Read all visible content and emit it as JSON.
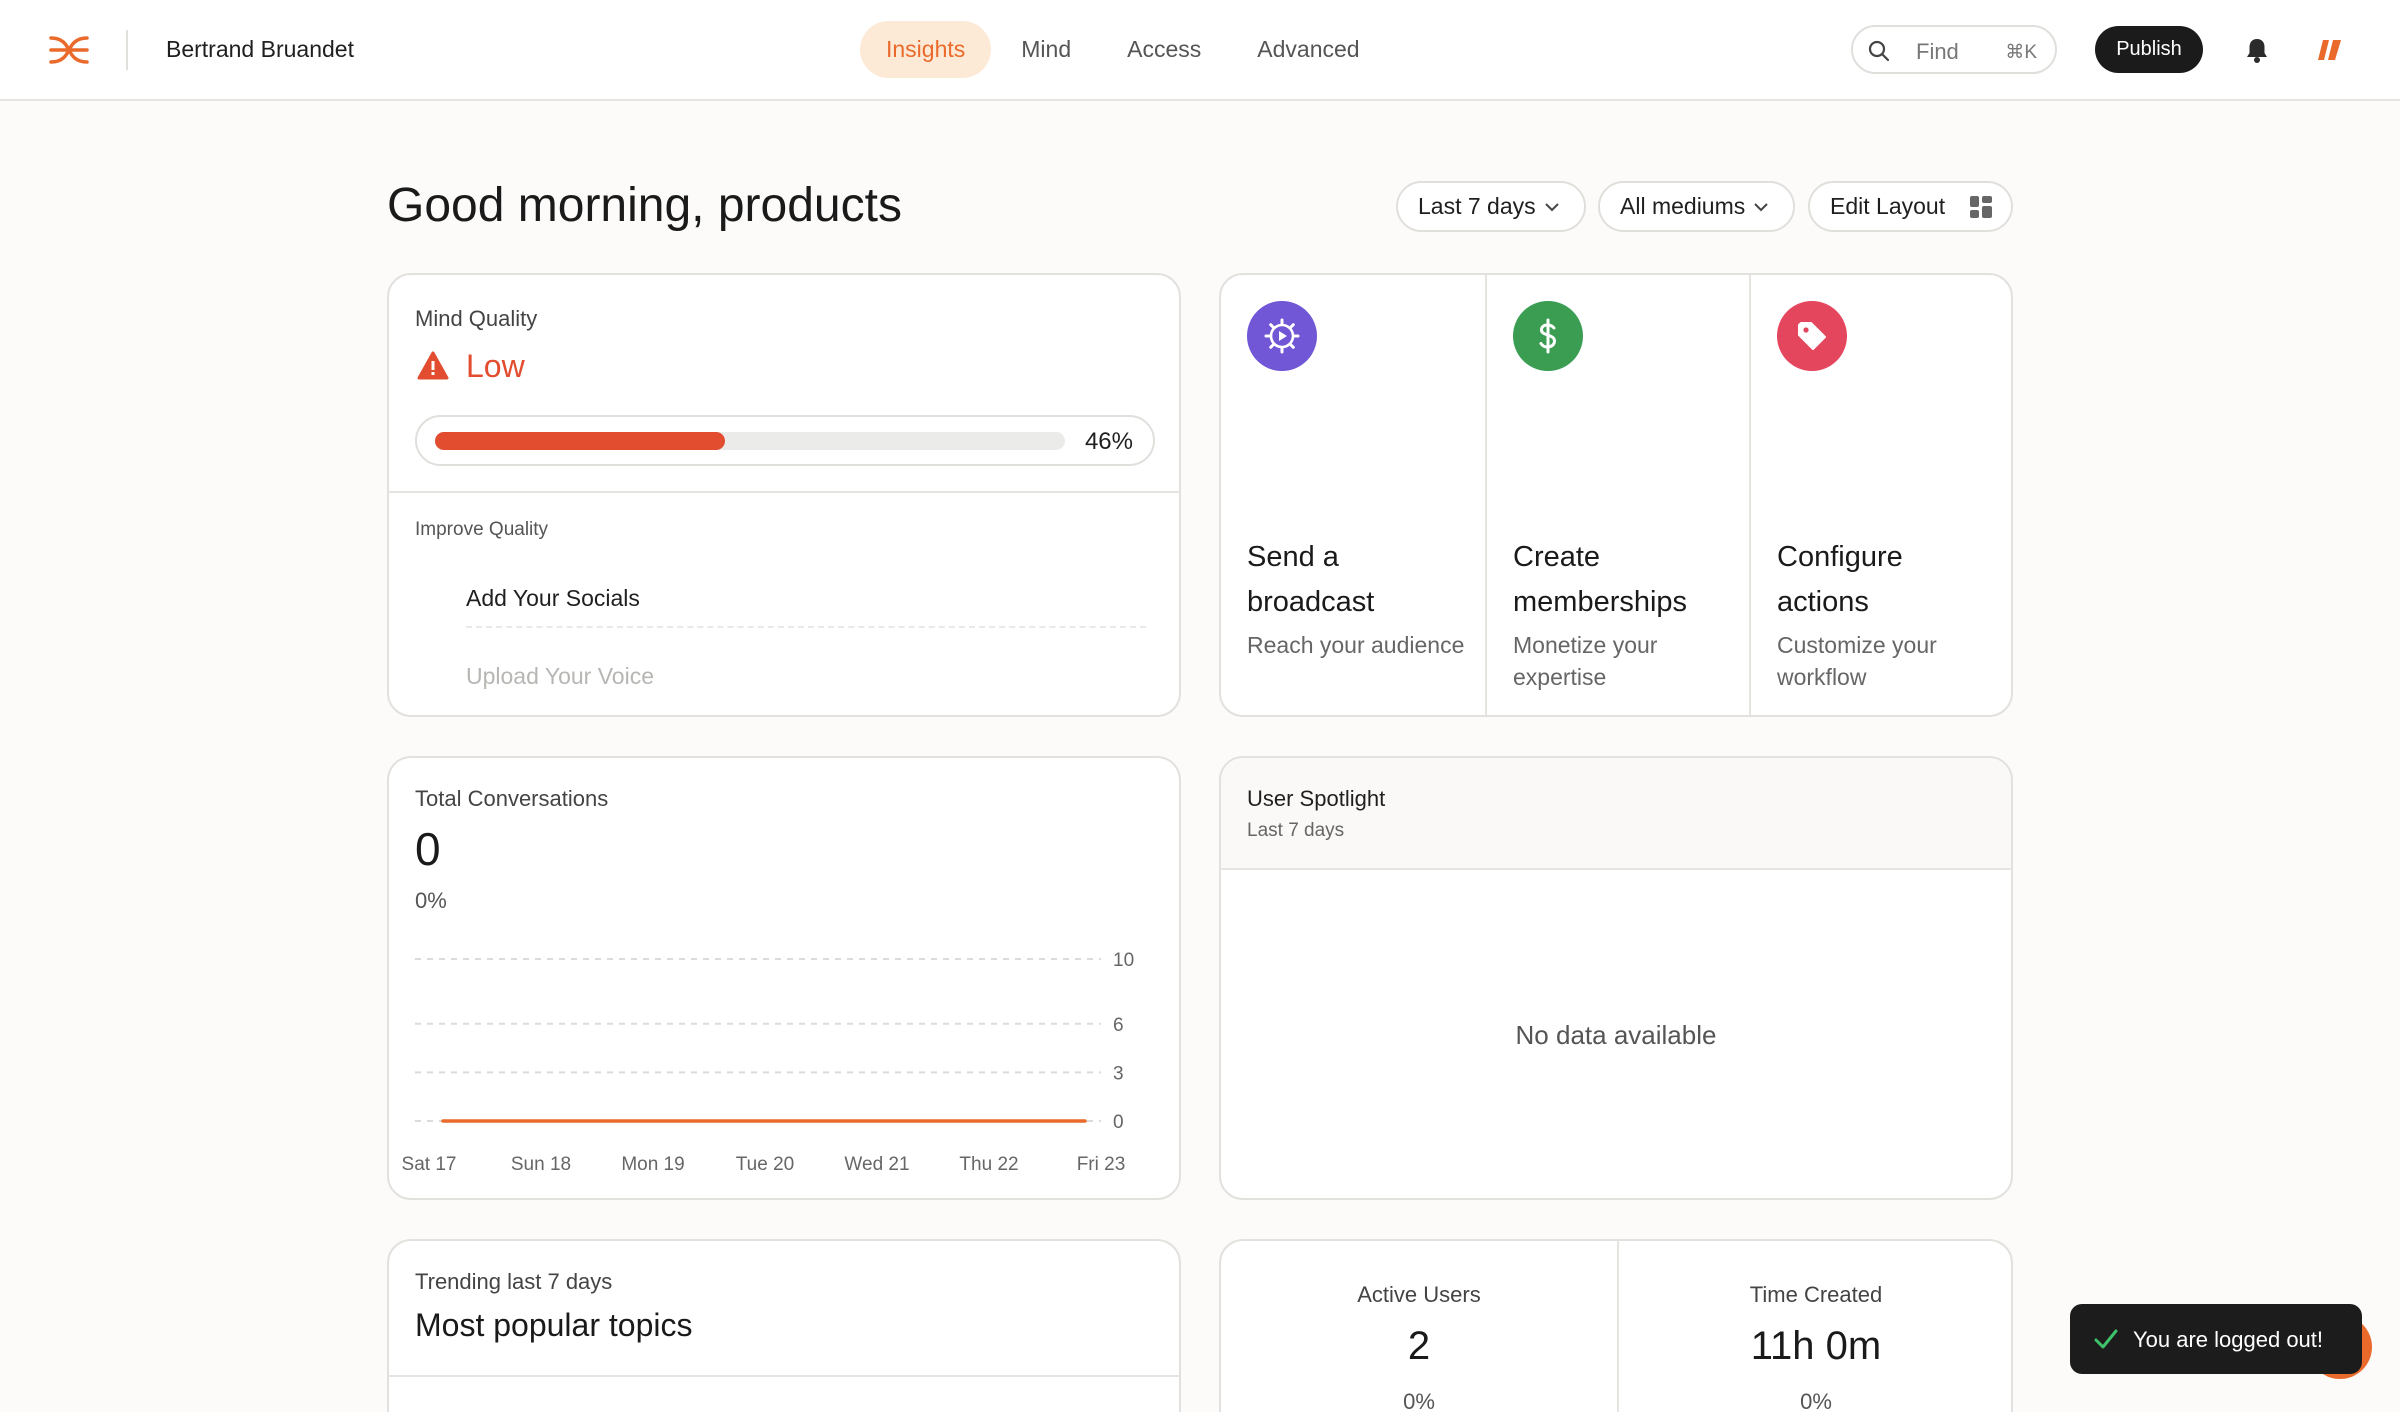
{
  "header": {
    "owner_name": "Bertrand Bruandet",
    "nav": [
      "Insights",
      "Mind",
      "Access",
      "Advanced"
    ],
    "active_tab": "Insights",
    "search": {
      "label": "Find",
      "shortcut": "⌘K"
    },
    "publish_label": "Publish",
    "logo_icon": "brand-logo-icon",
    "notification_icon": "bell-icon",
    "app_icon": "brand-mark-icon"
  },
  "toolbar": {
    "greeting": "Good morning, products",
    "range_filter": "Last 7 days",
    "medium_filter": "All mediums",
    "edit_layout": "Edit Layout"
  },
  "mind_quality": {
    "label": "Mind Quality",
    "level": "Low",
    "progress": 0.46,
    "progress_text": "46%",
    "improve_label": "Improve Quality",
    "tasks": [
      "Add Your Socials",
      "Upload Your Voice"
    ]
  },
  "actions": [
    {
      "title": "Send a broadcast",
      "subtitle": "Reach your audience",
      "icon": "broadcast-gear-icon",
      "color": "#7156d6"
    },
    {
      "title": "Create memberships",
      "subtitle": "Monetize your expertise",
      "icon": "dollar-icon",
      "color": "#3a9d52"
    },
    {
      "title": "Configure actions",
      "subtitle": "Customize your workflow",
      "icon": "tag-icon",
      "color": "#e4465e"
    }
  ],
  "conversations": {
    "label": "Total Conversations",
    "value": "0",
    "change": "0%"
  },
  "chart_data": {
    "type": "line",
    "categories": [
      "Sat 17",
      "Sun 18",
      "Mon 19",
      "Tue 20",
      "Wed 21",
      "Thu 22",
      "Fri 23"
    ],
    "series": [
      {
        "values": [
          0,
          0,
          0,
          0,
          0,
          0,
          0
        ]
      }
    ],
    "y_ticks": [
      0,
      3,
      6,
      10
    ],
    "ylim": [
      0,
      10
    ],
    "grid": true,
    "line_color": "#ea6a2b"
  },
  "spotlight": {
    "title": "User Spotlight",
    "subtitle": "Last 7 days",
    "empty": "No data available"
  },
  "trending": {
    "label": "Trending last 7 days",
    "title": "Most popular topics"
  },
  "stats": [
    {
      "label": "Active Users",
      "value": "2",
      "change": "0%"
    },
    {
      "label": "Time Created",
      "value": "11h 0m",
      "change": "0%"
    }
  ],
  "toast": {
    "message": "You are logged out!"
  },
  "colors": {
    "accent": "#ea6a2b",
    "warning": "#e24c2f",
    "active_tab_bg": "#fdead6"
  }
}
